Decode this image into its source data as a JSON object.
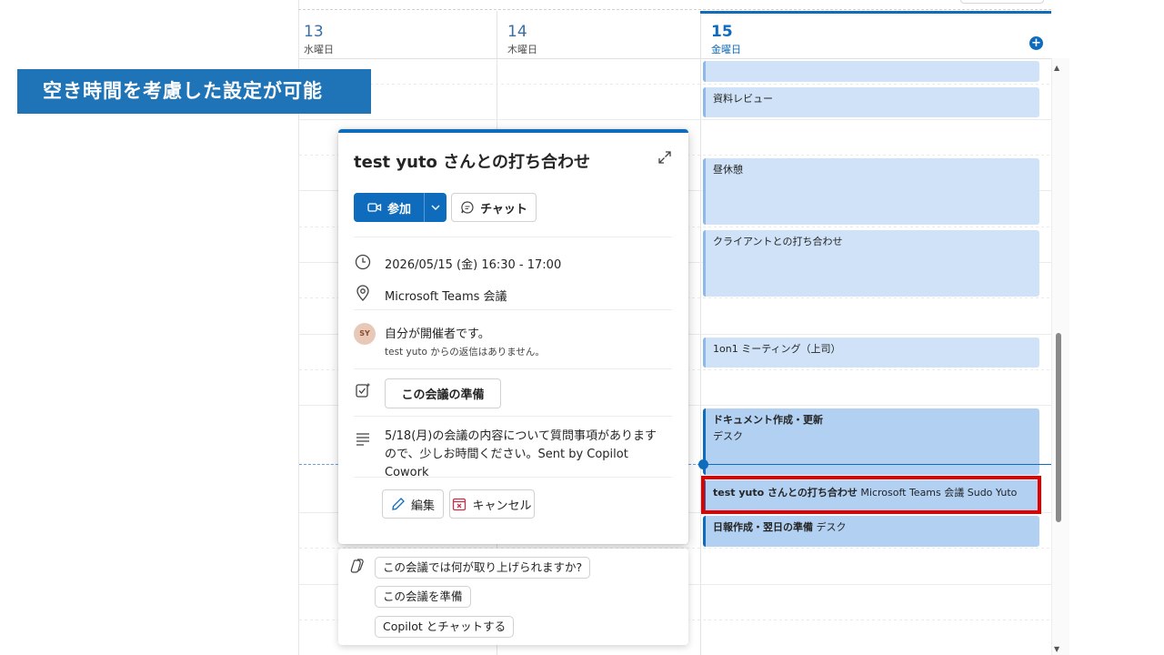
{
  "banner": {
    "text": "空き時間を考慮した設定が可能"
  },
  "calendar": {
    "days": [
      {
        "num": "13",
        "name": "水曜日"
      },
      {
        "num": "14",
        "name": "木曜日"
      },
      {
        "num": "15",
        "name": "金曜日"
      }
    ],
    "add_icon": "plus-icon",
    "events": {
      "review": "資料レビュー",
      "lunch": "昼休憩",
      "client": "クライアントとの打ち合わせ",
      "oneonone": "1on1 ミーティング（上司）",
      "doc_title": "ドキュメント作成・更新",
      "doc_location": "デスク",
      "meeting_title": "test yuto さんとの打ち合わせ",
      "meeting_detail": "Microsoft Teams 会議 Sudo Yuto",
      "report_title": "日報作成・翌日の準備",
      "report_location": "デスク"
    }
  },
  "popup": {
    "title": "test yuto さんとの打ち合わせ",
    "join_label": "参加",
    "chat_label": "チャット",
    "datetime": "2026/05/15 (金) 16:30 - 17:00",
    "location": "Microsoft Teams 会議",
    "avatar_initials": "SY",
    "organizer": "自分が開催者です。",
    "response_status": "test yuto からの返信はありません。",
    "prepare_label": "この会議の準備",
    "description": "5/18(月)の会議の内容について質問事項がありますので、少しお時間ください。Sent by Copilot Cowork",
    "edit_label": "編集",
    "cancel_label": "キャンセル"
  },
  "copilot": {
    "suggestions": [
      "この会議では何が取り上げられますか?",
      "この会議を準備",
      "Copilot とチャットする"
    ]
  },
  "colors": {
    "accent": "#0f6cbd",
    "banner": "#1f74b8",
    "event": "#cfe2f7",
    "highlight": "#e00000"
  }
}
